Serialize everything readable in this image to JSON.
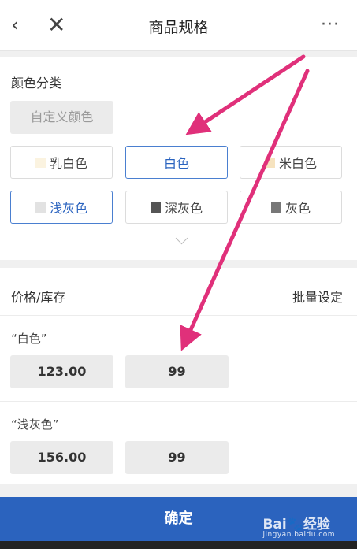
{
  "header": {
    "back_icon": "‹",
    "close_icon": "✕",
    "title": "商品规格",
    "more_icon": "···"
  },
  "colors": {
    "section_label": "颜色分类",
    "custom_button": "自定义颜色",
    "options": [
      {
        "label": "乳白色",
        "swatch": "#fbf3e0",
        "selected": false
      },
      {
        "label": "白色",
        "swatch": "",
        "selected": true
      },
      {
        "label": "米白色",
        "swatch": "#f6e3bf",
        "selected": false
      },
      {
        "label": "浅灰色",
        "swatch": "#e2e2e2",
        "selected": true
      },
      {
        "label": "深灰色",
        "swatch": "#555555",
        "selected": false
      },
      {
        "label": "灰色",
        "swatch": "#777777",
        "selected": false
      }
    ],
    "expand_icon": "chevron-down"
  },
  "pricing": {
    "section_label": "价格/库存",
    "bulk_set": "批量设定",
    "variants": [
      {
        "name": "“白色”",
        "price": "123.00",
        "stock": "99"
      },
      {
        "name": "“浅灰色”",
        "price": "156.00",
        "stock": "99"
      }
    ]
  },
  "confirm_label": "确定",
  "watermark": {
    "brand": "Bai🐾经验",
    "url": "jingyan.baidu.com"
  },
  "accent_color": "#2b63be",
  "annotation_color": "#e0307a"
}
